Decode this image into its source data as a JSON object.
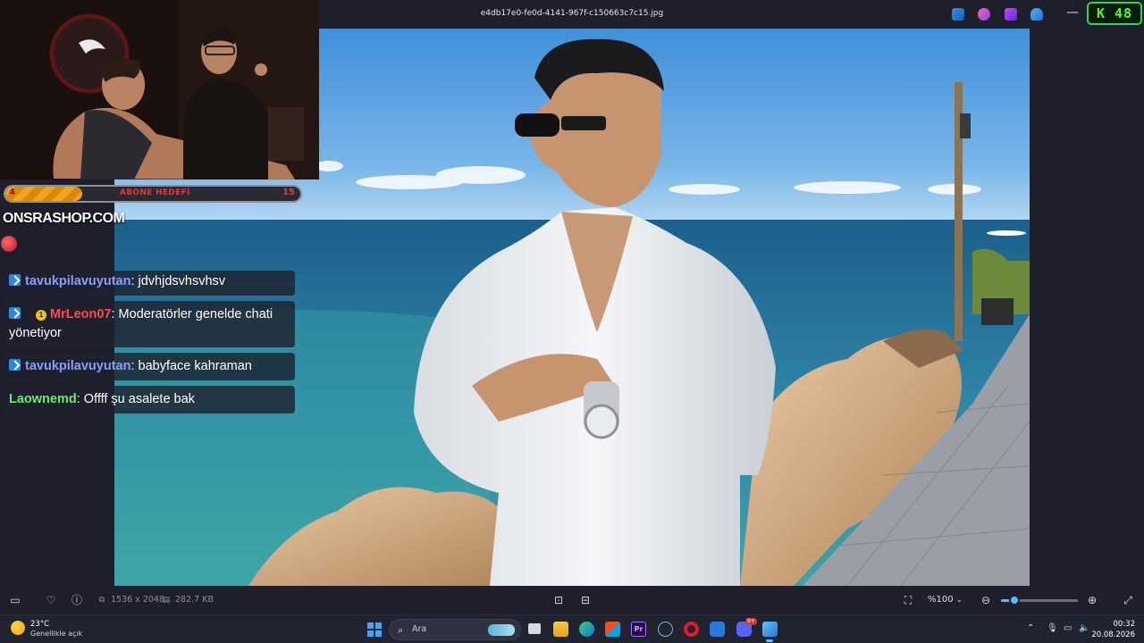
{
  "titlebar": {
    "file_name": "e4db17e0-fe0d-4141-967f-c150663c7c15.jpg",
    "minimize_symbol": "—",
    "kick_badge": "K 48",
    "icons": [
      "pin-icon",
      "paint-icon",
      "video-editor-icon",
      "cloud-icon"
    ]
  },
  "stream_overlay": {
    "goal": {
      "start": "4",
      "label": "ABONE HEDEFİ",
      "end": "15",
      "progress_fraction": 0.26
    },
    "shop_text": "ONSRASHOP.COM"
  },
  "chat": [
    {
      "username": "tavukpilavuyutan",
      "message": ": jdvhjdsvhsvhsv",
      "color": "blue"
    },
    {
      "badge": "1",
      "username": "MrLeon07",
      "message": ": Moderatörler genelde chati yönetiyor",
      "color": "red"
    },
    {
      "username": "tavukpilavuyutan",
      "message": ": babyface kahraman",
      "color": "blue"
    },
    {
      "username": "Laownemd",
      "message": ": Offff şu asalete bak",
      "color": "green"
    }
  ],
  "viewer_toolbar": {
    "dimensions": "1536 x 2048",
    "file_size": "282.7 KB",
    "zoom": "%100",
    "zoom_slider_fraction": 0.17
  },
  "taskbar": {
    "weather_temp": "23°C",
    "weather_desc": "Genellikle açık",
    "search_placeholder": "Ara",
    "time": "00:32",
    "date": "20.08.2026",
    "discord_badge": "9+"
  },
  "colors": {
    "accent": "#5cb8ff",
    "kick_green": "#53fc18",
    "goal_fill": "#f0a51c"
  }
}
